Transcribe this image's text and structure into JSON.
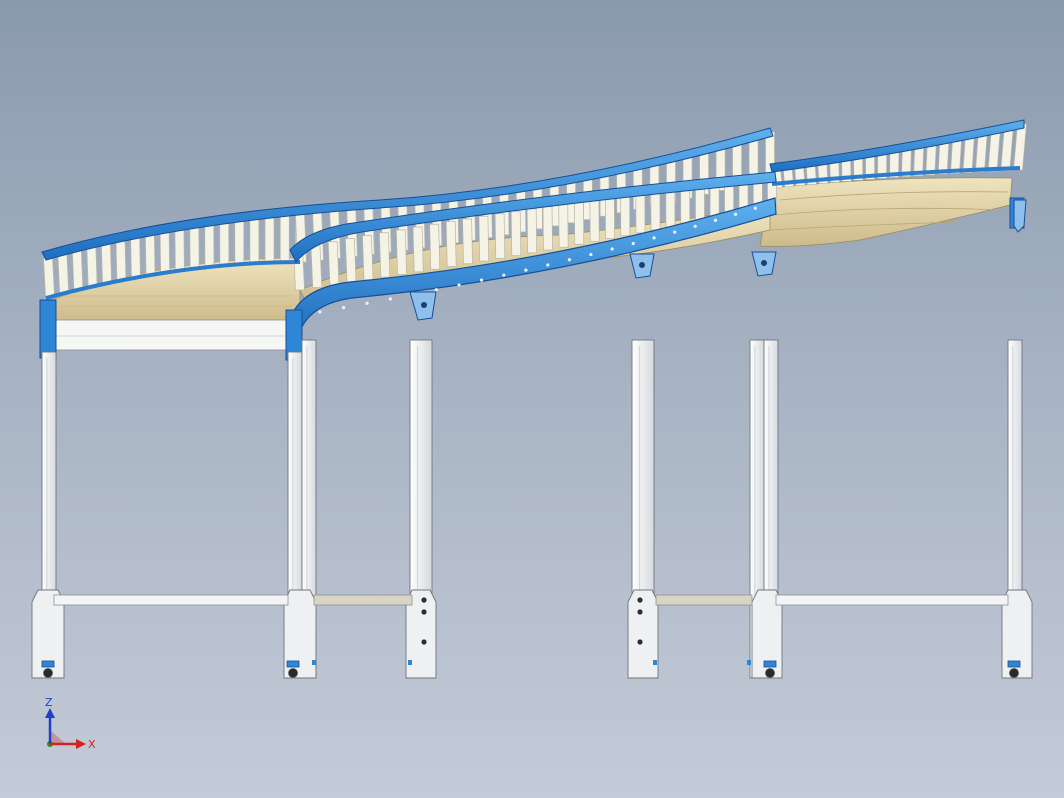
{
  "viewport": {
    "background_top": "#8a9aae",
    "background_bottom": "#c4cbd8"
  },
  "model": {
    "frame_color": "#2f86d6",
    "frame_edge_color": "#174f95",
    "roller_color": "#f5f2e6",
    "deck_color": "#dfd1a8",
    "leg_color": "#f3f4f6",
    "leg_edge_color": "#6f7680"
  },
  "triad": {
    "z_label": "Z",
    "x_label": "X",
    "z_color": "#1f3fc9",
    "x_color": "#d42020",
    "y_color": "#1a9a1a"
  }
}
